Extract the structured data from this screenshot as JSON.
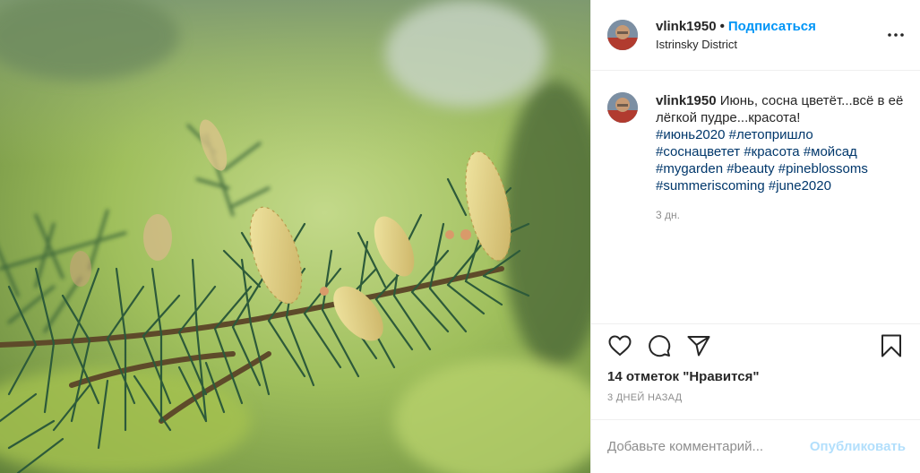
{
  "header": {
    "username": "vlink1950",
    "separator": "•",
    "follow_label": "Подписаться",
    "location": "Istrinsky District",
    "more_icon": "more-horizontal-icon"
  },
  "caption": {
    "username": "vlink1950",
    "text": "Июнь, сосна цветёт...всё в её лёгкой пудре...красота!",
    "hashtags": [
      "#июнь2020",
      "#летопришло",
      "#соснацветет",
      "#красота",
      "#мойсад",
      "#mygarden",
      "#beauty",
      "#pineblossoms",
      "#summeriscoming",
      "#june2020"
    ],
    "time": "3 дн."
  },
  "actions": {
    "like_icon": "heart-icon",
    "comment_icon": "comment-icon",
    "share_icon": "share-icon",
    "save_icon": "bookmark-icon"
  },
  "likes_text": "14 отметок \"Нравится\"",
  "date_text": "3 ДНЕЙ НАЗАД",
  "comment": {
    "placeholder": "Добавьте комментарий...",
    "publish_label": "Опубликовать"
  },
  "colors": {
    "accent": "#0095f6",
    "hashtag": "#00376b",
    "publish_disabled": "#b2dffc",
    "muted": "#8e8e8e"
  }
}
